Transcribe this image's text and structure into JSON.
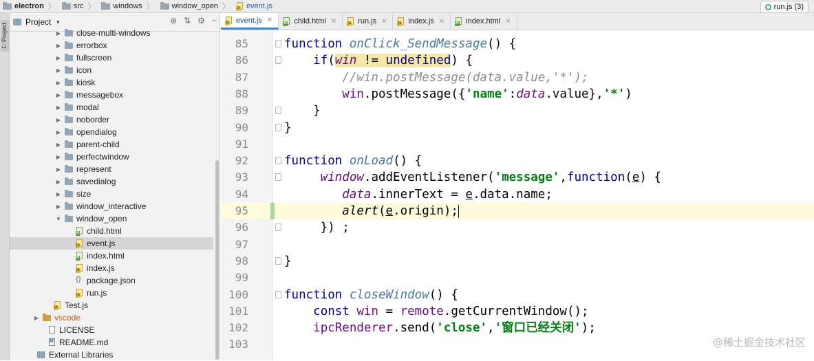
{
  "breadcrumb": [
    "electron",
    "src",
    "windows",
    "window_open",
    "event.js"
  ],
  "run_config": "run.js (3)",
  "tool_strip_label": "1: Project",
  "project_panel": {
    "title": "Project"
  },
  "tree": [
    {
      "label": "close-multi-windows",
      "type": "folder",
      "depth": 1
    },
    {
      "label": "errorbox",
      "type": "folder",
      "depth": 1
    },
    {
      "label": "fullscreen",
      "type": "folder",
      "depth": 1
    },
    {
      "label": "icon",
      "type": "folder",
      "depth": 1
    },
    {
      "label": "kiosk",
      "type": "folder",
      "depth": 1
    },
    {
      "label": "messagebox",
      "type": "folder",
      "depth": 1
    },
    {
      "label": "modal",
      "type": "folder",
      "depth": 1
    },
    {
      "label": "noborder",
      "type": "folder",
      "depth": 1
    },
    {
      "label": "opendialog",
      "type": "folder",
      "depth": 1
    },
    {
      "label": "parent-child",
      "type": "folder",
      "depth": 1
    },
    {
      "label": "perfectwindow",
      "type": "folder",
      "depth": 1
    },
    {
      "label": "represent",
      "type": "folder",
      "depth": 1
    },
    {
      "label": "savedialog",
      "type": "folder",
      "depth": 1
    },
    {
      "label": "size",
      "type": "folder",
      "depth": 1
    },
    {
      "label": "window_interactive",
      "type": "folder",
      "depth": 1
    },
    {
      "label": "window_open",
      "type": "folder-open",
      "depth": 1
    },
    {
      "label": "child.html",
      "type": "html",
      "depth": 2
    },
    {
      "label": "event.js",
      "type": "js",
      "depth": 2,
      "selected": true
    },
    {
      "label": "index.html",
      "type": "html",
      "depth": 2
    },
    {
      "label": "index.js",
      "type": "js",
      "depth": 2
    },
    {
      "label": "package.json",
      "type": "json",
      "depth": 2
    },
    {
      "label": "run.js",
      "type": "js",
      "depth": 2
    },
    {
      "label": "Test.js",
      "type": "js",
      "depth": 0
    },
    {
      "label": "vscode",
      "type": "folder-orange",
      "depth": -1
    },
    {
      "label": "LICENSE",
      "type": "txt",
      "depth": -0.5
    },
    {
      "label": "README.md",
      "type": "md",
      "depth": -0.5
    },
    {
      "label": "External Libraries",
      "type": "lib",
      "depth": -1.5
    }
  ],
  "tabs": [
    {
      "label": "event.js",
      "type": "js",
      "active": true
    },
    {
      "label": "child.html",
      "type": "html"
    },
    {
      "label": "run.js",
      "type": "js"
    },
    {
      "label": "index.js",
      "type": "js"
    },
    {
      "label": "index.html",
      "type": "html"
    }
  ],
  "code_lines": [
    {
      "n": "85",
      "fold": true,
      "html": "<span class='kw'>function</span> <span class='fn'>onClick_SendMessage</span>() {"
    },
    {
      "n": "86",
      "fold": true,
      "html": "    <span class='kw'>if</span>(<span class='hl'><span class='pur it'>win</span> != <span class='kw'>undefined</span></span>) {"
    },
    {
      "n": "87",
      "html": "        <span class='cm'>//win.postMessage(data.value,'*');</span>"
    },
    {
      "n": "88",
      "html": "        <span class='pur'>win</span>.postMessage({<span class='str'>'name'</span>:<span class='pur it'>data</span>.value},<span class='str'>'*'</span>)"
    },
    {
      "n": "89",
      "fold": true,
      "html": "    }"
    },
    {
      "n": "90",
      "fold": true,
      "html": "}"
    },
    {
      "n": "91",
      "html": ""
    },
    {
      "n": "92",
      "fold": true,
      "html": "<span class='kw'>function</span> <span class='fn'>onLoad</span>() {"
    },
    {
      "n": "93",
      "fold": true,
      "html": "     <span class='pur it'>window</span>.addEventListener(<span class='str'>'message'</span>,<span class='kw'>function</span>(<span class='und'>e</span>) {"
    },
    {
      "n": "94",
      "html": "        <span class='pur it'>data</span>.innerText = <span class='und'>e</span>.data.name;"
    },
    {
      "n": "95",
      "current": true,
      "html": "        <span class='it'>alert</span>(<span class='und'>e</span>.origin);<span class='cursor'></span>"
    },
    {
      "n": "96",
      "fold": true,
      "html": "     }) ;"
    },
    {
      "n": "97",
      "html": ""
    },
    {
      "n": "98",
      "fold": true,
      "html": "}"
    },
    {
      "n": "99",
      "html": ""
    },
    {
      "n": "100",
      "fold": true,
      "html": "<span class='kw'>function</span> <span class='fn'>closeWindow</span>() {"
    },
    {
      "n": "101",
      "html": "    <span class='kw'>const</span> <span class='pur'>win</span> = <span class='pur'>remote</span>.getCurrentWindow();"
    },
    {
      "n": "102",
      "html": "    <span class='pur'>ipcRenderer</span>.send(<span class='str'>'close'</span>,<span class='str'>'窗口已经关闭'</span>);"
    },
    {
      "n": "103",
      "html": ""
    }
  ],
  "watermark": "@稀土掘金技术社区"
}
